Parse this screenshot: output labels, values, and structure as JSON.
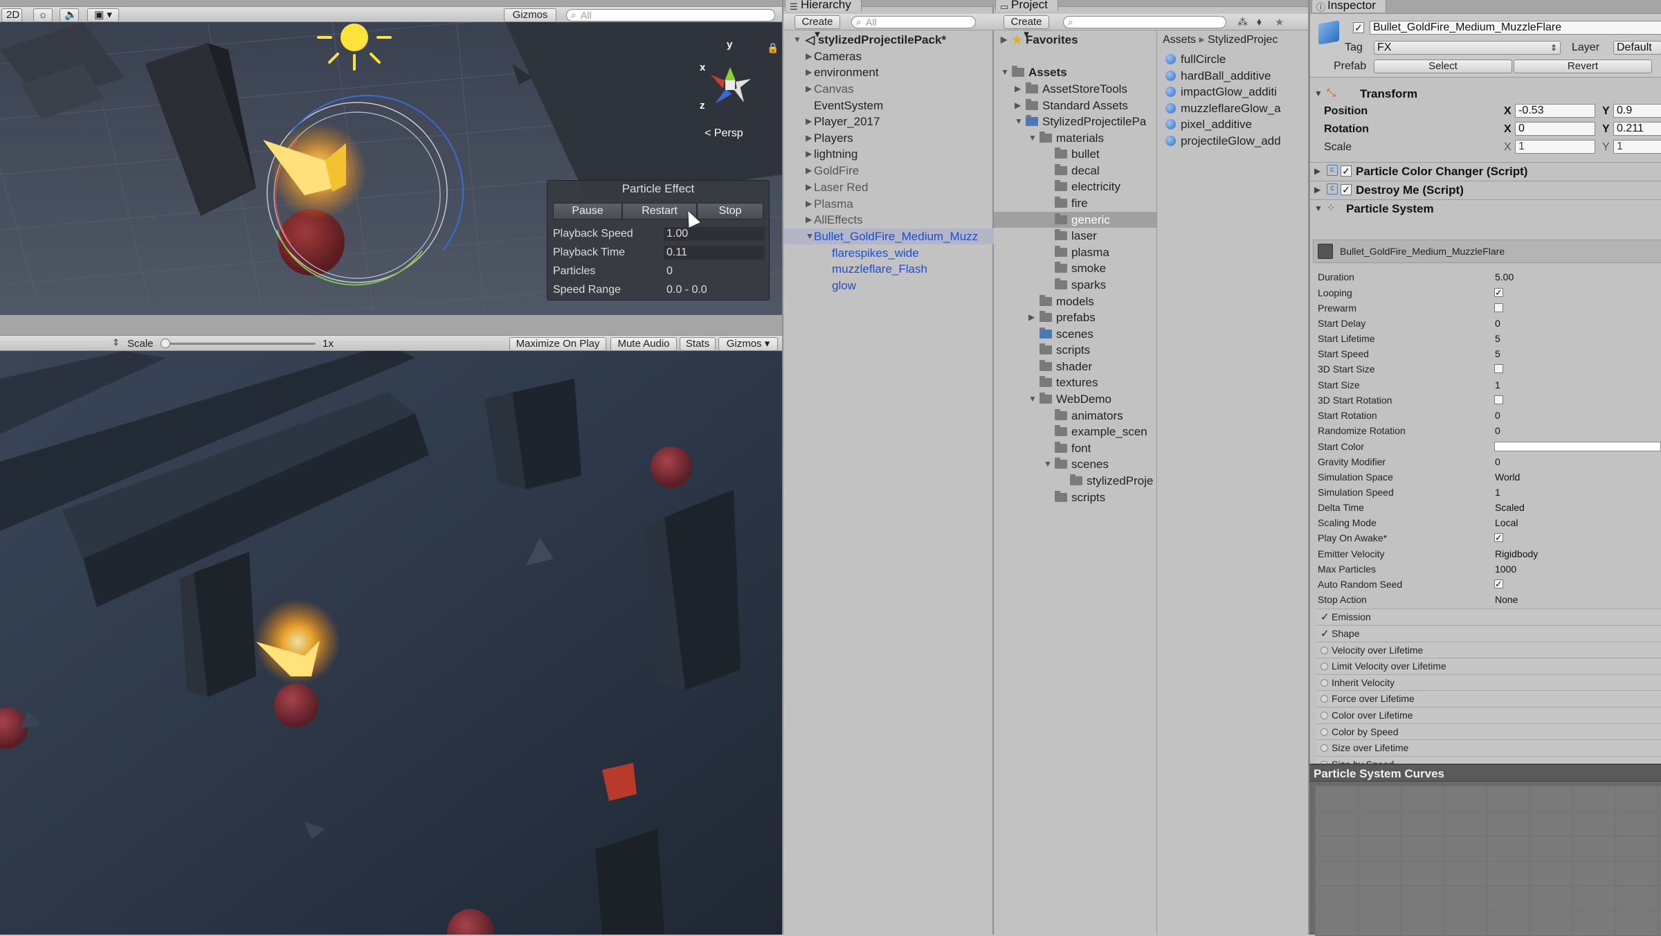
{
  "scene": {
    "toolbar": {
      "mode_2d": "2D",
      "gizmos": "Gizmos",
      "search_placeholder": "All"
    },
    "persp_label": "Persp",
    "axis_labels": {
      "x": "x",
      "y": "y",
      "z": "z"
    },
    "particle_panel": {
      "title": "Particle Effect",
      "buttons": {
        "pause": "Pause",
        "restart": "Restart",
        "stop": "Stop"
      },
      "rows": [
        {
          "label": "Playback Speed",
          "value": "1.00"
        },
        {
          "label": "Playback Time",
          "value": "0.11"
        },
        {
          "label": "Particles",
          "value": "0"
        },
        {
          "label": "Speed Range",
          "value": "0.0 - 0.0"
        }
      ]
    }
  },
  "game": {
    "toolbar": {
      "scale_label": "Scale",
      "scale_value": "1x",
      "maximize": "Maximize On Play",
      "mute": "Mute Audio",
      "stats": "Stats",
      "gizmos": "Gizmos"
    }
  },
  "hierarchy": {
    "tab": "Hierarchy",
    "create": "Create",
    "search_placeholder": "All",
    "scene_name": "stylizedProjectilePack*",
    "items": [
      "Cameras",
      "environment",
      "Canvas",
      "EventSystem",
      "Player_2017",
      "Players",
      "lightning",
      "GoldFire",
      "Laser Red",
      "Plasma",
      "AllEffects",
      "Bullet_GoldFire_Medium_Muzz"
    ],
    "children": [
      "flarespikes_wide",
      "muzzleflare_Flash",
      "glow"
    ]
  },
  "project": {
    "tab": "Project",
    "create": "Create",
    "favorites": "Favorites",
    "assets_root": "Assets",
    "breadcrumb": [
      "Assets",
      "StylizedProjec"
    ],
    "tree": {
      "asset_store_tools": "AssetStoreTools",
      "standard_assets": "Standard Assets",
      "stylized_pack": "StylizedProjectilePa",
      "materials": "materials",
      "material_folders": [
        "bullet",
        "decal",
        "electricity",
        "fire",
        "generic",
        "laser",
        "plasma",
        "smoke",
        "sparks"
      ],
      "pack_folders": [
        "models",
        "prefabs",
        "scenes",
        "scripts",
        "shader",
        "textures"
      ],
      "webdemo": "WebDemo",
      "webdemo_folders": [
        "animators",
        "example_scen",
        "font"
      ],
      "webdemo_scenes": "scenes",
      "webdemo_scene_child": "stylizedProje",
      "webdemo_scripts": "scripts"
    },
    "files": [
      "fullCircle",
      "hardBall_additive",
      "impactGlow_additi",
      "muzzleflareGlow_a",
      "pixel_additive",
      "projectileGlow_add"
    ]
  },
  "inspector": {
    "tab": "Inspector",
    "object_name": "Bullet_GoldFire_Medium_MuzzleFlare",
    "tag_label": "Tag",
    "tag_value": "FX",
    "layer_label": "Layer",
    "layer_value": "Default",
    "prefab_label": "Prefab",
    "select": "Select",
    "revert": "Revert",
    "transform": {
      "title": "Transform",
      "position_label": "Position",
      "position_x": "-0.53",
      "position_y": "0.9",
      "rotation_label": "Rotation",
      "rotation_x": "0",
      "rotation_y": "0.211",
      "scale_label": "Scale",
      "scale_x": "1",
      "scale_y": "1",
      "x": "X",
      "y": "Y"
    },
    "components": [
      "Particle Color Changer (Script)",
      "Destroy Me (Script)",
      "Particle System"
    ],
    "ps_name": "Bullet_GoldFire_Medium_MuzzleFlare",
    "ps_props": [
      {
        "label": "Duration",
        "value": "5.00"
      },
      {
        "label": "Looping",
        "check": true
      },
      {
        "label": "Prewarm",
        "check": false
      },
      {
        "label": "Start Delay",
        "value": "0"
      },
      {
        "label": "Start Lifetime",
        "value": "5"
      },
      {
        "label": "Start Speed",
        "value": "5"
      },
      {
        "label": "3D Start Size",
        "check": false
      },
      {
        "label": "Start Size",
        "value": "1"
      },
      {
        "label": "3D Start Rotation",
        "check": false
      },
      {
        "label": "Start Rotation",
        "value": "0"
      },
      {
        "label": "Randomize Rotation",
        "value": "0"
      },
      {
        "label": "Start Color",
        "color": "#ffffff"
      },
      {
        "label": "Gravity Modifier",
        "value": "0"
      },
      {
        "label": "Simulation Space",
        "value": "World"
      },
      {
        "label": "Simulation Speed",
        "value": "1"
      },
      {
        "label": "Delta Time",
        "value": "Scaled"
      },
      {
        "label": "Scaling Mode",
        "value": "Local"
      },
      {
        "label": "Play On Awake*",
        "check": true
      },
      {
        "label": "Emitter Velocity",
        "value": "Rigidbody"
      },
      {
        "label": "Max Particles",
        "value": "1000"
      },
      {
        "label": "Auto Random Seed",
        "check": true
      },
      {
        "label": "Stop Action",
        "value": "None"
      }
    ],
    "modules": [
      {
        "label": "Emission",
        "on": true
      },
      {
        "label": "Shape",
        "on": true
      },
      {
        "label": "Velocity over Lifetime",
        "on": false
      },
      {
        "label": "Limit Velocity over Lifetime",
        "on": false
      },
      {
        "label": "Inherit Velocity",
        "on": false
      },
      {
        "label": "Force over Lifetime",
        "on": false
      },
      {
        "label": "Color over Lifetime",
        "on": false
      },
      {
        "label": "Color by Speed",
        "on": false
      },
      {
        "label": "Size over Lifetime",
        "on": false
      },
      {
        "label": "Size by Speed",
        "on": false
      }
    ],
    "curves_title": "Particle System Curves"
  }
}
